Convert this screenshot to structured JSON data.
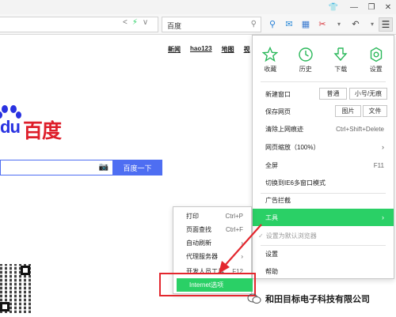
{
  "toolbar": {
    "search_value": "百度"
  },
  "page": {
    "nav_links": [
      "新闻",
      "hao123",
      "地图",
      "视"
    ],
    "logo_du": "du",
    "logo_cn": "百度",
    "search_button": "百度一下"
  },
  "main_menu": {
    "quick_actions": [
      {
        "label": "收藏",
        "icon": "star-icon"
      },
      {
        "label": "历史",
        "icon": "clock-icon"
      },
      {
        "label": "下载",
        "icon": "download-icon"
      },
      {
        "label": "设置",
        "icon": "gear-icon"
      }
    ],
    "new_window": {
      "label": "新建窗口",
      "normal": "普通",
      "mode": "小号/无痕"
    },
    "save_page": {
      "label": "保存网页",
      "image": "图片",
      "file": "文件"
    },
    "clear_history": {
      "label": "清除上网痕迹",
      "shortcut": "Ctrl+Shift+Delete"
    },
    "zoom": {
      "label": "网页缩放（100%）"
    },
    "fullscreen": {
      "label": "全屏",
      "shortcut": "F11"
    },
    "ie6_mode": {
      "label": "切换到IE6多窗口模式"
    },
    "ad_block": {
      "label": "广告拦截"
    },
    "tools": {
      "label": "工具"
    },
    "set_default": {
      "label": "设置为默认浏览器"
    },
    "settings": {
      "label": "设置"
    },
    "help": {
      "label": "帮助"
    }
  },
  "tools_menu": {
    "items": [
      {
        "label": "打印",
        "shortcut": "Ctrl+P"
      },
      {
        "label": "页面查找",
        "shortcut": "Ctrl+F"
      },
      {
        "label": "自动刷新",
        "shortcut": ""
      },
      {
        "label": "代理服务器",
        "shortcut": ""
      },
      {
        "label": "开发人员工具",
        "shortcut": "F12"
      },
      {
        "label": "Internet选项",
        "shortcut": ""
      }
    ]
  },
  "watermark": {
    "text": "和田目标电子科技有限公司"
  },
  "colors": {
    "accent_green": "#2ad066",
    "baidu_blue": "#4e6ef2",
    "baidu_red": "#de1e2a",
    "highlight_red": "#e3272e"
  }
}
